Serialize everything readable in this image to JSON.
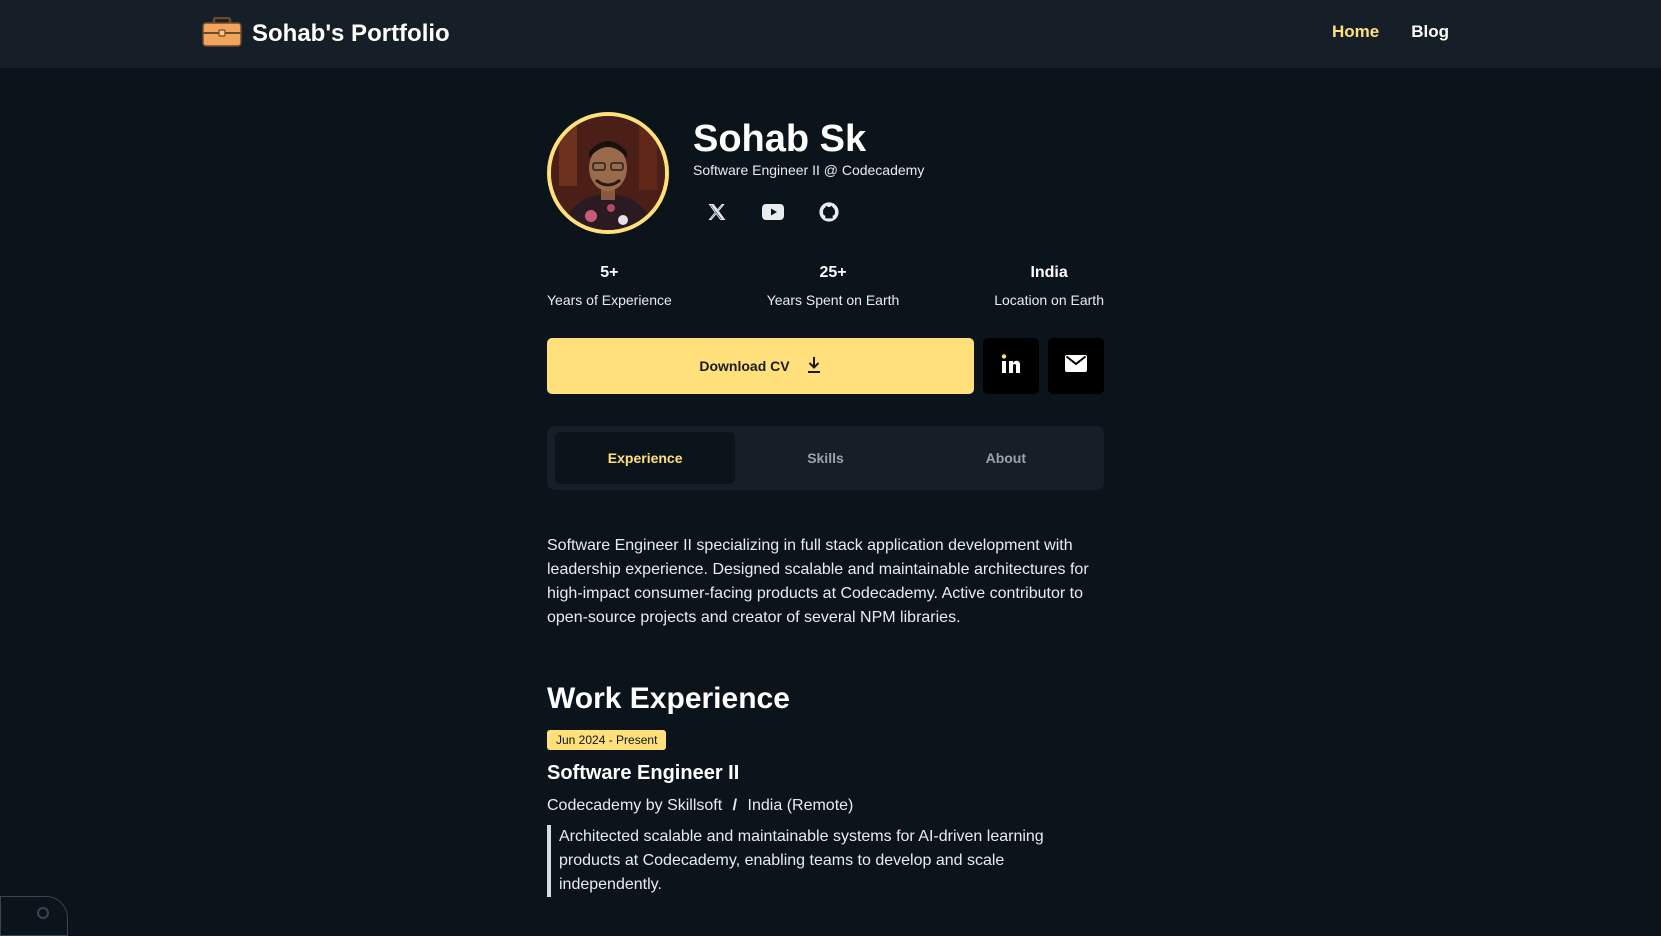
{
  "header": {
    "brand_icon": "briefcase-icon",
    "brand_title": "Sohab's Portfolio",
    "nav": [
      {
        "label": "Home",
        "active": true
      },
      {
        "label": "Blog",
        "active": false
      }
    ]
  },
  "profile": {
    "name": "Sohab Sk",
    "subtitle": "Software Engineer II @ Codecademy",
    "socials": [
      "x-twitter-icon",
      "youtube-icon",
      "github-icon"
    ]
  },
  "stats": [
    {
      "value": "5+",
      "label": "Years of Experience"
    },
    {
      "value": "25+",
      "label": "Years Spent on Earth"
    },
    {
      "value": "India",
      "label": "Location on Earth"
    }
  ],
  "actions": {
    "download_label": "Download CV",
    "download_icon": "download-icon",
    "linkedin_icon": "linkedin-icon",
    "email_icon": "mail-icon"
  },
  "tabs": [
    {
      "label": "Experience",
      "active": true
    },
    {
      "label": "Skills",
      "active": false
    },
    {
      "label": "About",
      "active": false
    }
  ],
  "summary": "Software Engineer II specializing in full stack application development with leadership experience. Designed scalable and maintainable architectures for high-impact consumer-facing products at Codecademy. Active contributor to open-source projects and creator of several NPM libraries.",
  "work": {
    "title": "Work Experience",
    "jobs": [
      {
        "date": "Jun 2024 - Present",
        "title": "Software Engineer II",
        "company": "Codecademy by Skillsoft",
        "separator": "/",
        "location": "India (Remote)",
        "description": "Architected scalable and maintainable systems for AI-driven learning products at Codecademy, enabling teams to develop and scale independently."
      }
    ]
  },
  "colors": {
    "accent": "#ffe07a",
    "background": "#0b141a",
    "navbar": "#161e27"
  }
}
